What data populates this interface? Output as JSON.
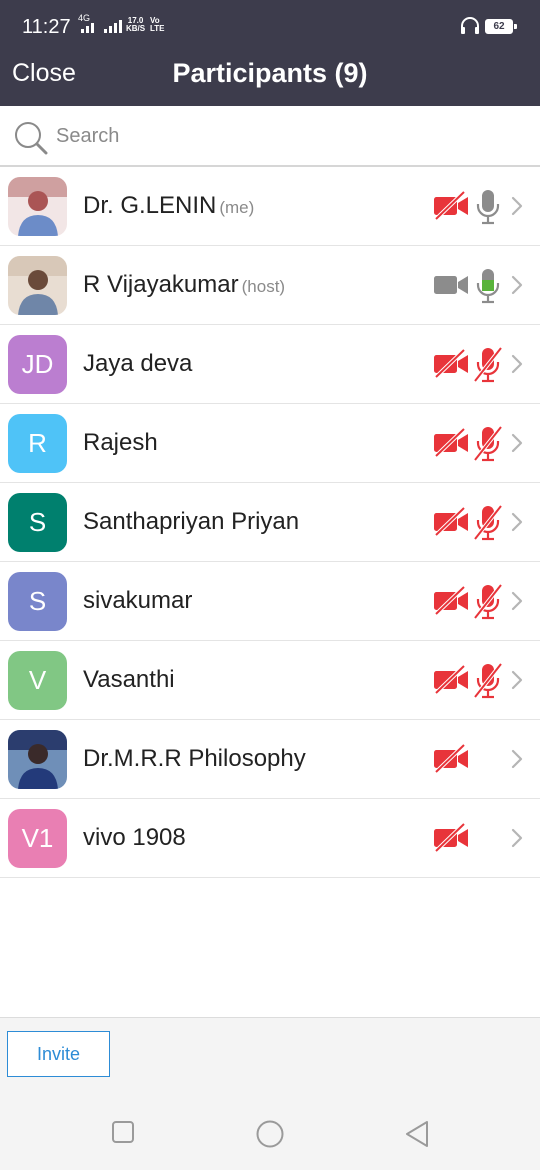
{
  "status_bar": {
    "time": "11:27",
    "network": "4G",
    "speed_value": "17.0",
    "speed_unit": "KB/S",
    "volte": "Vo",
    "lte": "LTE",
    "battery": "62"
  },
  "header": {
    "close_label": "Close",
    "title": "Participants (9)"
  },
  "search": {
    "placeholder": "Search"
  },
  "participants": [
    {
      "name": "Dr. G.LENIN",
      "role": "(me)",
      "avatar_type": "photo",
      "video": "off",
      "audio": "idle"
    },
    {
      "name": "R Vijayakumar",
      "role": "(host)",
      "avatar_type": "photo",
      "video": "on",
      "audio": "speaking"
    },
    {
      "name": "Jaya deva",
      "role": "",
      "initials": "JD",
      "avatar_color": "#bb7ed0",
      "video": "off",
      "audio": "muted"
    },
    {
      "name": "Rajesh",
      "role": "",
      "initials": "R",
      "avatar_color": "#4fc3f7",
      "video": "off",
      "audio": "muted"
    },
    {
      "name": "Santhapriyan Priyan",
      "role": "",
      "initials": "S",
      "avatar_color": "#00806e",
      "video": "off",
      "audio": "muted"
    },
    {
      "name": "sivakumar",
      "role": "",
      "initials": "S",
      "avatar_color": "#7986cb",
      "video": "off",
      "audio": "muted"
    },
    {
      "name": "Vasanthi",
      "role": "",
      "initials": "V",
      "avatar_color": "#81c784",
      "video": "off",
      "audio": "muted"
    },
    {
      "name": "Dr.M.R.R Philosophy",
      "role": "",
      "avatar_type": "photo",
      "video": "off",
      "audio": "none"
    },
    {
      "name": "vivo 1908",
      "role": "",
      "initials": "V1",
      "avatar_color": "#e97fb3",
      "video": "off",
      "audio": "none"
    }
  ],
  "footer": {
    "invite_label": "Invite"
  },
  "colors": {
    "header_bg": "#3d3c4c",
    "muted_red": "#e8343a",
    "speaking_green": "#58b33a",
    "icon_gray": "#8c8c8c",
    "invite_blue": "#2d8cd6"
  },
  "icons": {
    "navbar": [
      "recents-square-icon",
      "home-circle-icon",
      "back-triangle-icon"
    ]
  }
}
